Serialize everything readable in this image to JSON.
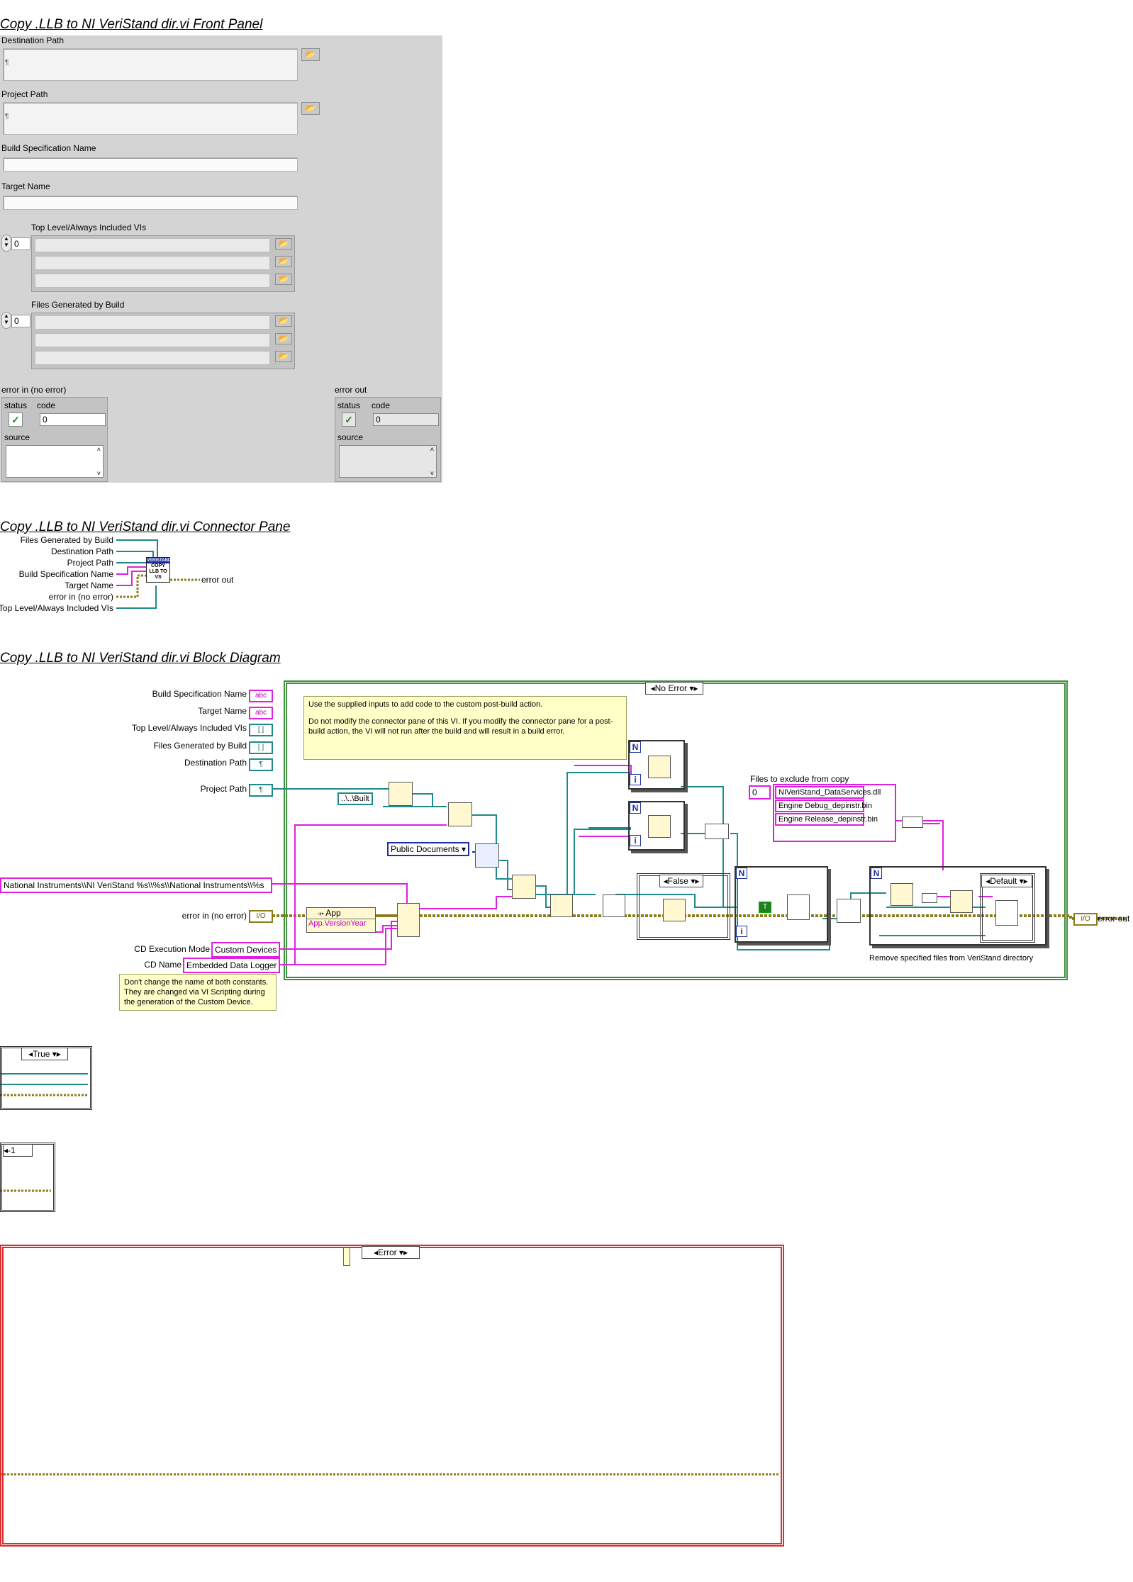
{
  "front_panel": {
    "title": "Copy .LLB to NI VeriStand dir.vi Front Panel",
    "destination_path": {
      "label": "Destination Path"
    },
    "project_path": {
      "label": "Project Path"
    },
    "build_spec_name": {
      "label": "Build Specification Name",
      "value": ""
    },
    "target_name": {
      "label": "Target Name",
      "value": ""
    },
    "top_level_vis": {
      "label": "Top Level/Always Included VIs",
      "index": "0"
    },
    "files_generated": {
      "label": "Files Generated by Build",
      "index": "0"
    },
    "error_in": {
      "label": "error in (no error)",
      "status_label": "status",
      "code_label": "code",
      "code_value": "0",
      "source_label": "source"
    },
    "error_out": {
      "label": "error out",
      "status_label": "status",
      "code_label": "code",
      "code_value": "0",
      "source_label": "source"
    }
  },
  "connector_pane": {
    "title": "Copy .LLB to NI VeriStand dir.vi Connector Pane",
    "inputs": [
      "Files Generated by Build",
      "Destination Path",
      "Project Path",
      "Build Specification Name",
      "Target Name",
      "error in (no error)",
      "Top Level/Always Included VIs"
    ],
    "output": "error out",
    "icon_text": [
      "VERISTAND",
      "COPY",
      "LLB TO",
      "VS"
    ]
  },
  "block_diagram": {
    "title": "Copy .LLB to NI VeriStand dir.vi Block Diagram",
    "controls": [
      "Build Specification Name",
      "Target Name",
      "Top Level/Always Included VIs",
      "Files Generated by Build",
      "Destination Path",
      "Project Path"
    ],
    "error_in_label": "error in (no error)",
    "error_out_label": "error out",
    "cd_execution_mode_label": "CD Execution Mode",
    "cd_execution_mode_value": "Custom Devices",
    "cd_name_label": "CD Name",
    "cd_name_value": "Embedded Data Logger",
    "format_string": "National Instruments\\\\NI VeriStand %s\\\\%s\\\\National Instruments\\\\%s",
    "note_top": "Use the supplied inputs to add code to the custom post-build action.",
    "note_top_2": "Do not modify the connector pane of this VI.  If you modify the connector pane for a post-build action, the VI will not run after the build and will result in a build error.",
    "note_bottom": "Don't change the name of both constants. They are changed via VI Scripting during the generation of the Custom Device.",
    "case_no_error": "No Error",
    "case_false": "False",
    "case_default": "Default",
    "case_true": "True",
    "case_minus1": "-1",
    "case_error": "Error",
    "relative_path": "..\\..\\Built",
    "public_documents": "Public Documents",
    "property_class": "App",
    "property_name": "App.VersionYear",
    "exclude_label": "Files to exclude from copy",
    "exclude_index": "0",
    "exclude_files": [
      "NIVeriStand_DataServices.dll",
      "Engine Debug_depinstr.bin",
      "Engine Release_depinstr.bin"
    ],
    "remove_label": "Remove specified files from VeriStand directory",
    "loop_n": "N",
    "loop_i": "i",
    "bool_t": "T"
  }
}
